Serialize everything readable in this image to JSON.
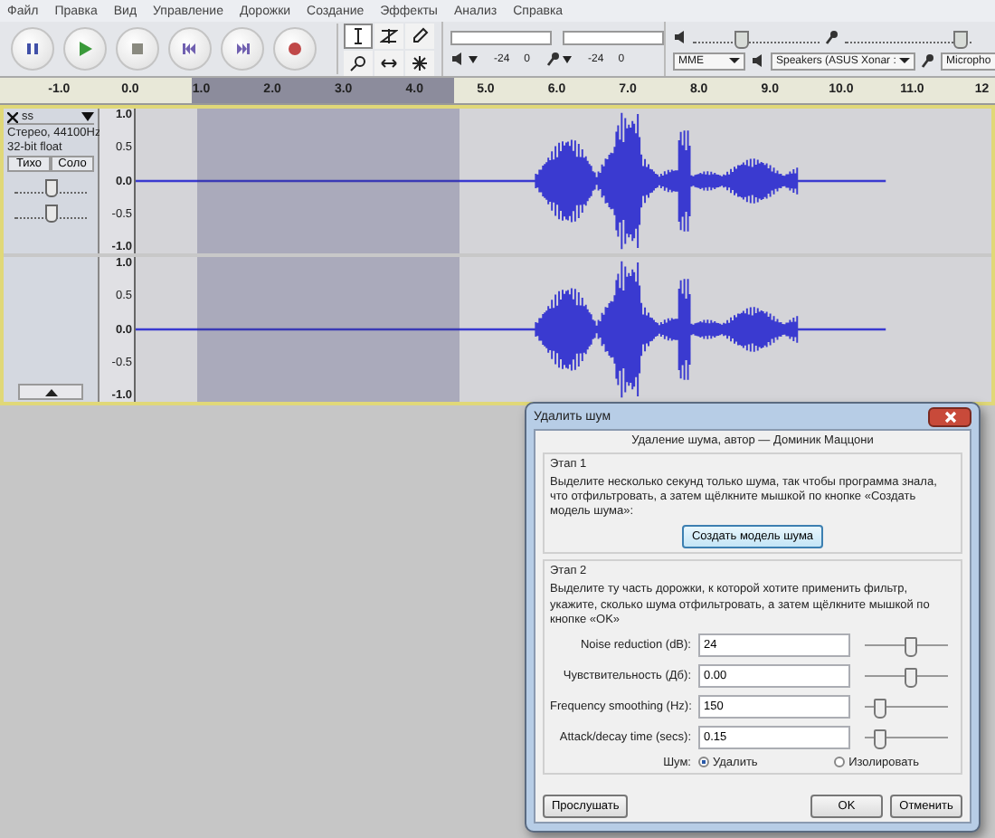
{
  "menu": [
    "Файл",
    "Правка",
    "Вид",
    "Управление",
    "Дорожки",
    "Создание",
    "Эффекты",
    "Анализ",
    "Справка"
  ],
  "meters": {
    "scale": [
      "-24",
      "0",
      "-24",
      "0"
    ]
  },
  "mixer": {
    "output_volume": {
      "level": 0.37
    },
    "input_volume": {
      "level": 0.9
    },
    "host": "MME",
    "output_device": "Speakers (ASUS Xonar :",
    "input_device": "Micropho"
  },
  "ruler": [
    "-1.0",
    "0.0",
    "1.0",
    "2.0",
    "3.0",
    "4.0",
    "5.0",
    "6.0",
    "7.0",
    "8.0",
    "9.0",
    "10.0",
    "11.0",
    "12"
  ],
  "track": {
    "name": "ss",
    "format": "Стерео, 44100Hz",
    "sample": "32-bit float",
    "mute": "Тихо",
    "solo": "Соло",
    "gain": {
      "level": 0.5
    },
    "pan": {
      "level": 0.5
    },
    "channels": [
      {
        "scale": [
          "1.0",
          "0.5",
          "0.0",
          "-0.5",
          "-1.0"
        ]
      },
      {
        "scale": [
          "1.0",
          "0.5",
          "0.0",
          "-0.5",
          "-1.0"
        ]
      }
    ]
  },
  "dialog": {
    "title": "Удалить шум",
    "heading": "Удаление шума, автор — Доминик Маццони",
    "stage1": {
      "title": "Этап 1",
      "text": "Выделите несколько секунд только шума, так чтобы программа знала, что отфильтровать, а затем щёлкните мышкой по кнопке «Создать модель шума»:",
      "button": "Создать модель шума"
    },
    "stage2": {
      "title": "Этап 2",
      "text": "Выделите ту часть дорожки, к которой хотите применить фильтр, укажите, сколько шума отфильтровать, а затем щёлкните мышкой по кнопке «OK»"
    },
    "params": [
      {
        "label": "Noise reduction (dB):",
        "value": "24",
        "level": 0.55
      },
      {
        "label": "Чувствительность (Дб):",
        "value": "0.00",
        "level": 0.55
      },
      {
        "label": "Frequency smoothing (Hz):",
        "value": "150",
        "level": 0.17
      },
      {
        "label": "Attack/decay time (secs):",
        "value": "0.15",
        "level": 0.17
      }
    ],
    "noise_label": "Шум:",
    "noise_options": [
      {
        "label": "Удалить",
        "selected": true
      },
      {
        "label": "Изолировать",
        "selected": false
      }
    ],
    "preview": "Прослушать",
    "ok": "OK",
    "cancel": "Отменить"
  }
}
